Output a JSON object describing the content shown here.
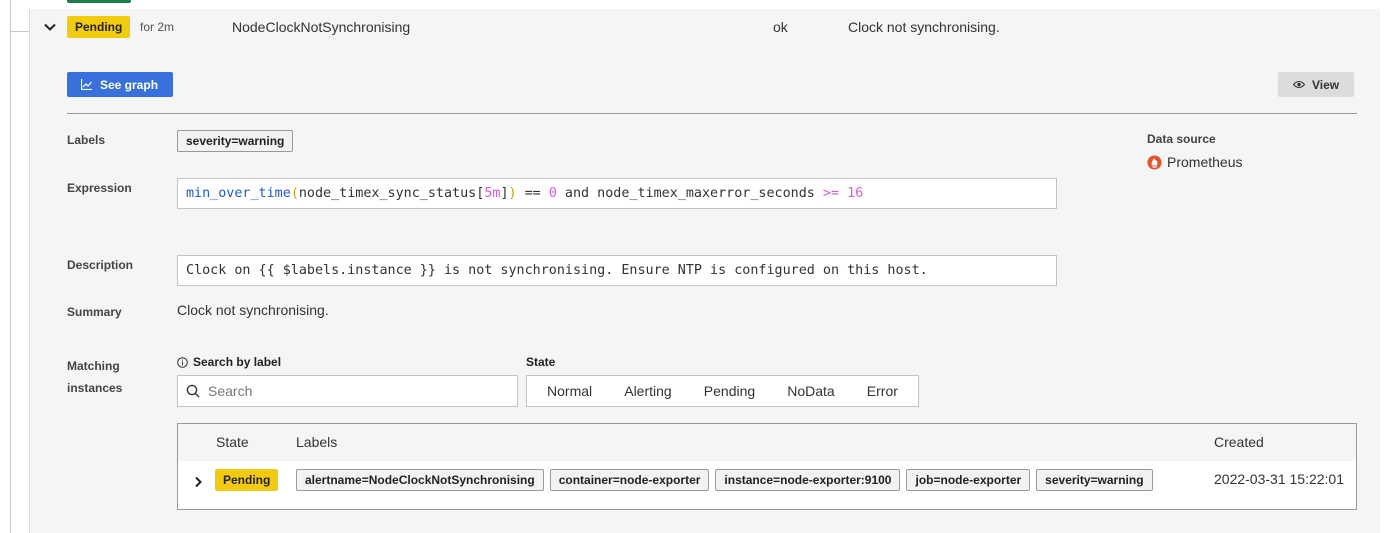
{
  "rule": {
    "state_badge": "Pending",
    "duration": "for 2m",
    "name": "NodeClockNotSynchronising",
    "health": "ok",
    "summary": "Clock not synchronising."
  },
  "actions": {
    "see_graph": "See graph",
    "view": "View"
  },
  "details": {
    "labels_label": "Labels",
    "labels": [
      "severity=warning"
    ],
    "expression_label": "Expression",
    "expression_tokens": [
      {
        "t": "min_over_time",
        "k": "fn"
      },
      {
        "t": "(",
        "k": "op"
      },
      {
        "t": "node_timex_sync_status[",
        "k": "plain"
      },
      {
        "t": "5m",
        "k": "num"
      },
      {
        "t": "]",
        "k": "plain"
      },
      {
        "t": ")",
        "k": "op"
      },
      {
        "t": " == ",
        "k": "plain"
      },
      {
        "t": "0",
        "k": "num"
      },
      {
        "t": " and node_timex_maxerror_seconds ",
        "k": "plain"
      },
      {
        "t": ">= 16",
        "k": "num"
      }
    ],
    "description_label": "Description",
    "description": "Clock on {{ $labels.instance }} is not synchronising. Ensure NTP is configured on this host.",
    "summary_label": "Summary",
    "summary": "Clock not synchronising.",
    "data_source_label": "Data source",
    "data_source": "Prometheus"
  },
  "matching": {
    "label_line1": "Matching",
    "label_line2": "instances",
    "search_label": "Search by label",
    "search_placeholder": "Search",
    "state_label": "State",
    "state_options": [
      "Normal",
      "Alerting",
      "Pending",
      "NoData",
      "Error"
    ],
    "table": {
      "headers": {
        "state": "State",
        "labels": "Labels",
        "created": "Created"
      },
      "rows": [
        {
          "state": "Pending",
          "labels": [
            "alertname=NodeClockNotSynchronising",
            "container=node-exporter",
            "instance=node-exporter:9100",
            "job=node-exporter",
            "severity=warning"
          ],
          "created": "2022-03-31 15:22:01"
        }
      ]
    }
  },
  "colors": {
    "pending": "#f2cc0c",
    "primary": "#3871dc",
    "fn_token": "#1f5bc8",
    "number_token": "#d25dde",
    "paren_token": "#d8a000"
  }
}
